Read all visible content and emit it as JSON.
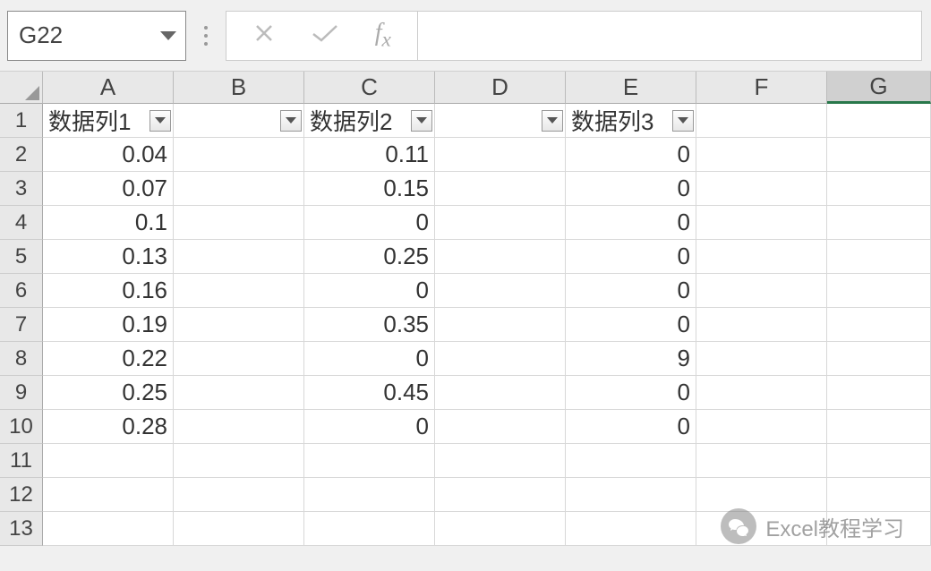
{
  "nameBox": "G22",
  "formulaInput": "",
  "columns": [
    "A",
    "B",
    "C",
    "D",
    "E",
    "F",
    "G"
  ],
  "selectedColumn": "G",
  "rowNumbers": [
    "1",
    "2",
    "3",
    "4",
    "5",
    "6",
    "7",
    "8",
    "9",
    "10",
    "11",
    "12",
    "13"
  ],
  "headerRow": {
    "A": "数据列1",
    "C": "数据列2",
    "E": "数据列3"
  },
  "filterCells": [
    "A1",
    "B1",
    "C1",
    "D1",
    "E1"
  ],
  "data": {
    "A": [
      "0.04",
      "0.07",
      "0.1",
      "0.13",
      "0.16",
      "0.19",
      "0.22",
      "0.25",
      "0.28"
    ],
    "C": [
      "0.11",
      "0.15",
      "0",
      "0.25",
      "0",
      "0.35",
      "0",
      "0.45",
      "0"
    ],
    "E": [
      "0",
      "0",
      "0",
      "0",
      "0",
      "0",
      "9",
      "0",
      "0"
    ]
  },
  "watermark": "Excel教程学习"
}
